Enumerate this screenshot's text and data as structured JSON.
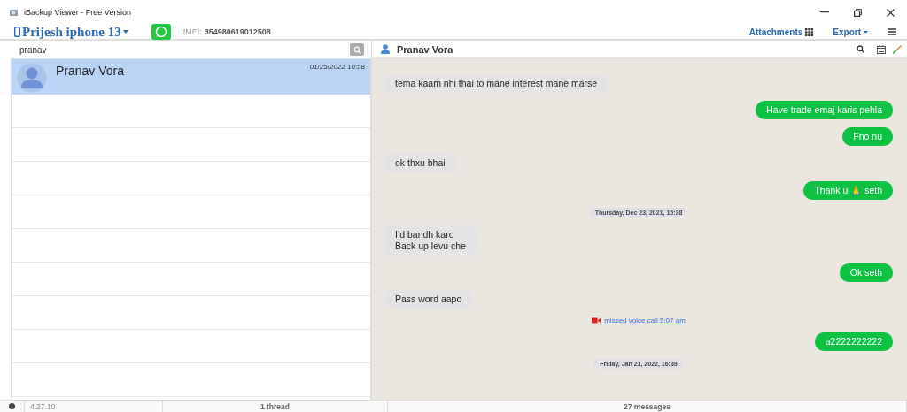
{
  "window": {
    "title": "iBackup Viewer - Free Version"
  },
  "toolbar": {
    "device": "Prijesh iphone 13",
    "imei_label": "IMEI:",
    "imei": "354980619012508",
    "attachments": "Attachments",
    "export": "Export"
  },
  "search": {
    "value": "pranav"
  },
  "threads": [
    {
      "name": "Pranav Vora",
      "time": "01/25/2022 10:58",
      "selected": true
    }
  ],
  "chat": {
    "contact": "Pranav Vora",
    "messages": [
      {
        "kind": "incoming",
        "lines": [
          "tema kaam nhi thai to mane interest mane marse"
        ]
      },
      {
        "kind": "outgoing",
        "lines": [
          "Have trade emaj karis pehla"
        ]
      },
      {
        "kind": "outgoing",
        "lines": [
          "Fno nu"
        ]
      },
      {
        "kind": "incoming",
        "lines": [
          "ok thxu bhai"
        ]
      },
      {
        "kind": "outgoing",
        "lines": [
          "Thank u 🙏 seth"
        ]
      },
      {
        "kind": "date",
        "lines": [
          "Thursday, Dec 23, 2021, 15:38"
        ]
      },
      {
        "kind": "incoming",
        "lines": [
          "I’d bandh karo",
          "Back up levu che"
        ]
      },
      {
        "kind": "outgoing",
        "lines": [
          "Ok seth"
        ]
      },
      {
        "kind": "incoming",
        "lines": [
          "Pass word aapo"
        ]
      },
      {
        "kind": "call",
        "lines": [
          "missed voice call 5:07 am"
        ]
      },
      {
        "kind": "outgoing",
        "lines": [
          "a2222222222"
        ]
      },
      {
        "kind": "date",
        "lines": [
          "Friday, Jan 21, 2022, 16:39"
        ]
      }
    ]
  },
  "status_bar": {
    "version": "4.27.10",
    "threads": "1 thread",
    "messages": "27 messages"
  }
}
